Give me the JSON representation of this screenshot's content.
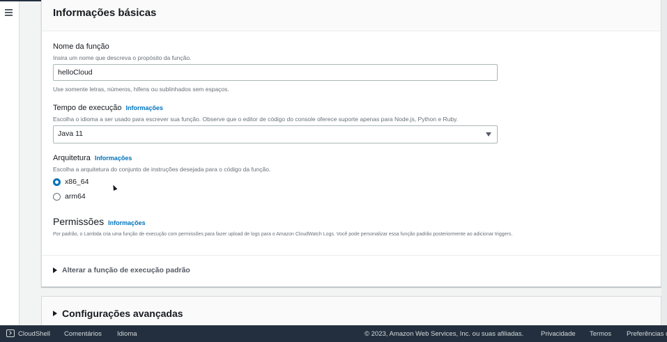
{
  "section": {
    "title": "Informações básicas"
  },
  "function_name": {
    "label": "Nome da função",
    "description": "Insira um nome que descreva o propósito da função.",
    "value": "helloCloud",
    "constraint": "Use somente letras, números, hifens ou sublinhados sem espaços."
  },
  "runtime": {
    "label": "Tempo de execução",
    "info_link": "Informações",
    "description": "Escolha o idioma a ser usado para escrever sua função. Observe que o editor de código do console oferece suporte apenas para Node.js, Python e Ruby.",
    "selected": "Java 11"
  },
  "architecture": {
    "label": "Arquitetura",
    "info_link": "Informações",
    "description": "Escolha a arquitetura do conjunto de instruções desejada para o código da função.",
    "options": [
      {
        "label": "x86_64",
        "checked": true
      },
      {
        "label": "arm64",
        "checked": false
      }
    ]
  },
  "permissions": {
    "title": "Permissões",
    "info_link": "Informações",
    "description": "Por padrão, o Lambda cria uma função de execução com permissões para fazer upload de logs para o Amazon CloudWatch Logs. Você pode personalizar essa função padrão posteriormente ao adicionar triggers.",
    "expander_label": "Alterar a função de execução padrão"
  },
  "advanced": {
    "title": "Configurações avançadas"
  },
  "footer": {
    "cloudshell": "CloudShell",
    "comments": "Comentários",
    "language": "Idioma",
    "copyright": "© 2023, Amazon Web Services, Inc. ou suas afiliadas.",
    "privacy": "Privacidade",
    "terms": "Termos",
    "preferences": "Preferências de"
  },
  "icons": {
    "menu": "hamburger-menu-icon",
    "cloudshell": "terminal-icon",
    "dropdown": "caret-down-icon",
    "expander": "caret-right-icon"
  },
  "colors": {
    "link": "#0073bb",
    "footer_bg": "#232f3e",
    "radio_selected": "#0073bb"
  }
}
